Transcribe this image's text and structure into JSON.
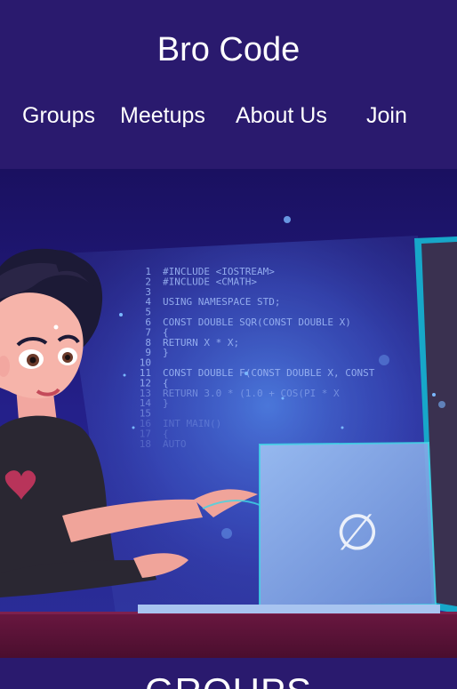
{
  "header": {
    "title": "Bro Code",
    "nav": [
      "Groups",
      "Meetups",
      "About Us",
      "Join"
    ]
  },
  "hero": {
    "code_lines": [
      {
        "num": "1",
        "text": "#INCLUDE <IOSTREAM>"
      },
      {
        "num": "2",
        "text": "#INCLUDE <CMATH>"
      },
      {
        "num": "3",
        "text": ""
      },
      {
        "num": "4",
        "text": "USING NAMESPACE STD;"
      },
      {
        "num": "5",
        "text": ""
      },
      {
        "num": "6",
        "text": "CONST DOUBLE SQR(CONST DOUBLE X)"
      },
      {
        "num": "7",
        "text": "{"
      },
      {
        "num": "8",
        "text": "    RETURN X * X;"
      },
      {
        "num": "9",
        "text": "}"
      },
      {
        "num": "10",
        "text": ""
      },
      {
        "num": "11",
        "text": "CONST DOUBLE F(CONST DOUBLE X, CONST"
      },
      {
        "num": "12",
        "text": "{"
      },
      {
        "num": "13",
        "text": "    RETURN 3.0 * (1.0 + COS(PI * X"
      },
      {
        "num": "14",
        "text": "}"
      },
      {
        "num": "15",
        "text": ""
      },
      {
        "num": "16",
        "text": "INT MAIN()"
      },
      {
        "num": "17",
        "text": "{"
      },
      {
        "num": "18",
        "text": "   AUTO"
      }
    ],
    "laptop_logo": "∅"
  },
  "section": {
    "heading": "GROUPS"
  },
  "colors": {
    "header_bg": "#2a1a6e",
    "hero_bg": "#1e1470",
    "screen_glow": "#3d6bd8",
    "desk": "#5a1338",
    "laptop": "#7a9fe0"
  }
}
